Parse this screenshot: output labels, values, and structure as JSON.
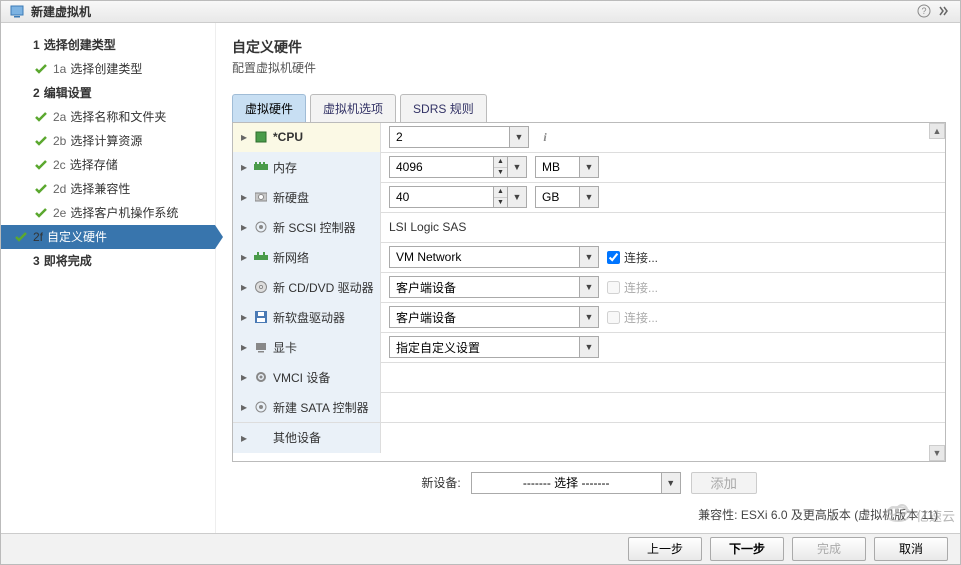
{
  "titlebar": {
    "title": "新建虚拟机"
  },
  "sidebar": {
    "steps": [
      {
        "num": "1",
        "label": "选择创建类型",
        "major": true
      },
      {
        "num": "1a",
        "label": "选择创建类型",
        "done": true
      },
      {
        "num": "2",
        "label": "编辑设置",
        "major": true
      },
      {
        "num": "2a",
        "label": "选择名称和文件夹",
        "done": true
      },
      {
        "num": "2b",
        "label": "选择计算资源",
        "done": true
      },
      {
        "num": "2c",
        "label": "选择存储",
        "done": true
      },
      {
        "num": "2d",
        "label": "选择兼容性",
        "done": true
      },
      {
        "num": "2e",
        "label": "选择客户机操作系统",
        "done": true
      },
      {
        "num": "2f",
        "label": "自定义硬件",
        "current": true
      },
      {
        "num": "3",
        "label": "即将完成",
        "major": true
      }
    ]
  },
  "main": {
    "title": "自定义硬件",
    "subtitle": "配置虚拟机硬件",
    "tabs": [
      "虚拟硬件",
      "虚拟机选项",
      "SDRS 规则"
    ],
    "active_tab": 0,
    "rows": {
      "cpu": {
        "label": "*CPU",
        "value": "2"
      },
      "memory": {
        "label": "内存",
        "value": "4096",
        "unit": "MB"
      },
      "disk": {
        "label": "新硬盘",
        "value": "40",
        "unit": "GB"
      },
      "scsi": {
        "label": "新 SCSI 控制器",
        "value": "LSI Logic SAS"
      },
      "network": {
        "label": "新网络",
        "value": "VM Network",
        "connect": "连接..."
      },
      "cdrom": {
        "label": "新 CD/DVD 驱动器",
        "value": "客户端设备",
        "connect": "连接..."
      },
      "floppy": {
        "label": "新软盘驱动器",
        "value": "客户端设备",
        "connect": "连接..."
      },
      "gpu": {
        "label": "显卡",
        "value": "指定自定义设置"
      },
      "vmci": {
        "label": "VMCI 设备"
      },
      "sata": {
        "label": "新建 SATA 控制器"
      },
      "other": {
        "label": "其他设备"
      }
    },
    "new_device": {
      "label": "新设备:",
      "select_placeholder": "------- 选择 -------",
      "add": "添加"
    },
    "compat": "兼容性: ESXi 6.0 及更高版本 (虚拟机版本 11)"
  },
  "footer": {
    "back": "上一步",
    "next": "下一步",
    "finish": "完成",
    "cancel": "取消"
  },
  "watermark": {
    "text": "亿速云"
  }
}
